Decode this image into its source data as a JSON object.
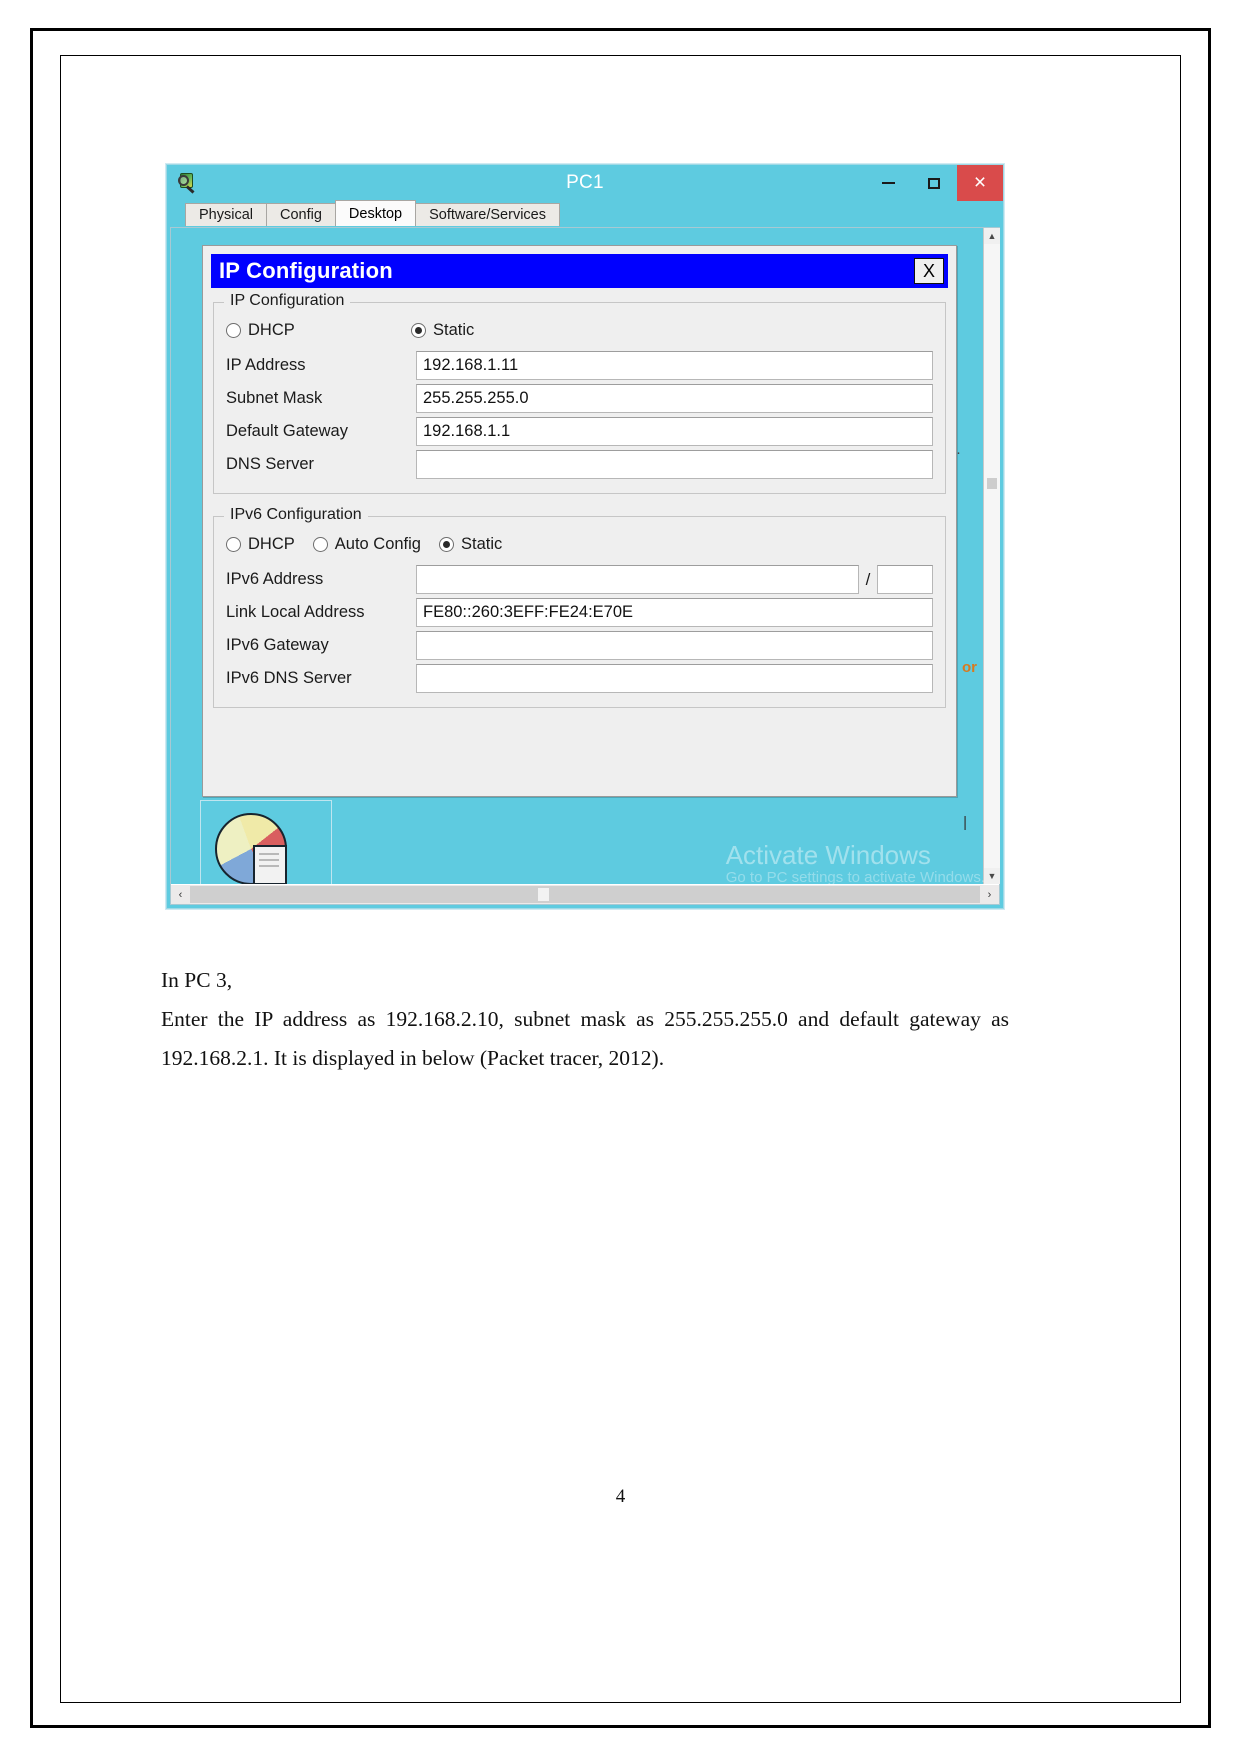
{
  "document": {
    "page_number": "4",
    "paragraphs": [
      "In PC 3,",
      "Enter the IP address as 192.168.2.10, subnet mask as 255.255.255.0 and default gateway as 192.168.2.1. It is displayed in below (Packet tracer, 2012)."
    ]
  },
  "window": {
    "title": "PC1",
    "buttons": {
      "minimize": "–",
      "maximize": "□",
      "close": "×"
    },
    "tabs": [
      {
        "label": "Physical",
        "active": false
      },
      {
        "label": "Config",
        "active": false
      },
      {
        "label": "Desktop",
        "active": true
      },
      {
        "label": "Software/Services",
        "active": false
      }
    ]
  },
  "dialog": {
    "title": "IP Configuration",
    "close_label": "X",
    "ipv4": {
      "legend": "IP Configuration",
      "modes": [
        {
          "label": "DHCP",
          "selected": false
        },
        {
          "label": "Static",
          "selected": true
        }
      ],
      "fields": [
        {
          "label": "IP Address",
          "value": "192.168.1.11"
        },
        {
          "label": "Subnet Mask",
          "value": "255.255.255.0"
        },
        {
          "label": "Default Gateway",
          "value": "192.168.1.1"
        },
        {
          "label": "DNS Server",
          "value": ""
        }
      ]
    },
    "ipv6": {
      "legend": "IPv6 Configuration",
      "modes": [
        {
          "label": "DHCP",
          "selected": false
        },
        {
          "label": "Auto Config",
          "selected": false
        },
        {
          "label": "Static",
          "selected": true
        }
      ],
      "fields": [
        {
          "label": "IPv6 Address",
          "value": "",
          "prefix": "",
          "has_prefix": true
        },
        {
          "label": "Link Local Address",
          "value": "FE80::260:3EFF:FE24:E70E",
          "has_prefix": false
        },
        {
          "label": "IPv6 Gateway",
          "value": "",
          "has_prefix": false
        },
        {
          "label": "IPv6 DNS Server",
          "value": "",
          "has_prefix": false
        }
      ],
      "prefix_separator": "/"
    }
  },
  "scrollbars": {
    "vertical_up": "▲",
    "vertical_down": "▼",
    "horizontal_left": "‹",
    "horizontal_right": "›"
  },
  "bleed_text": {
    "orange_fragment": "or",
    "dash_fragment": "·",
    "bar_fragment": "|"
  },
  "watermark": {
    "line1": "Activate Windows",
    "line2": "Go to PC settings to activate Windows."
  },
  "colors": {
    "window_chrome": "#5ecbe0",
    "dialog_title_bg": "#0000ff",
    "close_button_bg": "#d94b4b",
    "dialog_bg": "#efefef"
  }
}
